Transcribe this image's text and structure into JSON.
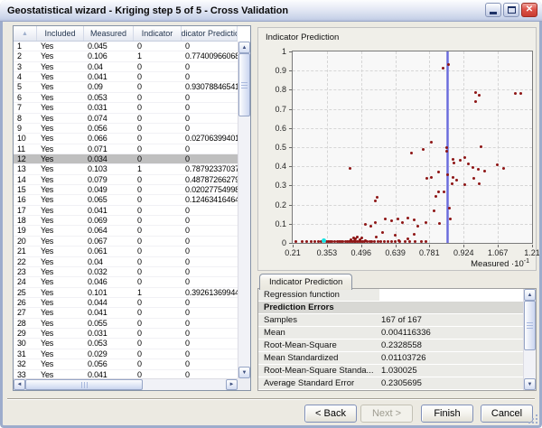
{
  "window": {
    "title": "Geostatistical wizard - Kriging step 5 of 5 - Cross Validation"
  },
  "icons": {
    "sort_ascending": "▲",
    "minimize": "–",
    "maximize": "□",
    "close": "✕",
    "scroll_up": "▲",
    "scroll_down": "▼",
    "scroll_left": "◄",
    "scroll_right": "►"
  },
  "table": {
    "headers": [
      "",
      "Included",
      "Measured",
      "Indicator",
      "Indicator Prediction"
    ],
    "selected_row": 12,
    "rows": [
      [
        "1",
        "Yes",
        "0.045",
        "0",
        "0"
      ],
      [
        "2",
        "Yes",
        "0.106",
        "1",
        "0.774009660680..."
      ],
      [
        "3",
        "Yes",
        "0.04",
        "0",
        "0"
      ],
      [
        "4",
        "Yes",
        "0.041",
        "0",
        "0"
      ],
      [
        "5",
        "Yes",
        "0.09",
        "0",
        "0.930788465417..."
      ],
      [
        "6",
        "Yes",
        "0.053",
        "0",
        "0"
      ],
      [
        "7",
        "Yes",
        "0.031",
        "0",
        "0"
      ],
      [
        "8",
        "Yes",
        "0.074",
        "0",
        "0"
      ],
      [
        "9",
        "Yes",
        "0.056",
        "0",
        "0"
      ],
      [
        "10",
        "Yes",
        "0.066",
        "0",
        "0.027063994010..."
      ],
      [
        "11",
        "Yes",
        "0.071",
        "0",
        "0"
      ],
      [
        "12",
        "Yes",
        "0.034",
        "0",
        "0"
      ],
      [
        "13",
        "Yes",
        "0.103",
        "1",
        "0.787923370375..."
      ],
      [
        "14",
        "Yes",
        "0.079",
        "0",
        "0.487872662791..."
      ],
      [
        "15",
        "Yes",
        "0.049",
        "0",
        "0.020277549986..."
      ],
      [
        "16",
        "Yes",
        "0.065",
        "0",
        "0.12463416464..."
      ],
      [
        "17",
        "Yes",
        "0.041",
        "0",
        "0"
      ],
      [
        "18",
        "Yes",
        "0.069",
        "0",
        "0"
      ],
      [
        "19",
        "Yes",
        "0.064",
        "0",
        "0"
      ],
      [
        "20",
        "Yes",
        "0.067",
        "0",
        "0"
      ],
      [
        "21",
        "Yes",
        "0.061",
        "0",
        "0"
      ],
      [
        "22",
        "Yes",
        "0.04",
        "0",
        "0"
      ],
      [
        "23",
        "Yes",
        "0.032",
        "0",
        "0"
      ],
      [
        "24",
        "Yes",
        "0.046",
        "0",
        "0"
      ],
      [
        "25",
        "Yes",
        "0.101",
        "1",
        "0.392613699448..."
      ],
      [
        "26",
        "Yes",
        "0.044",
        "0",
        "0"
      ],
      [
        "27",
        "Yes",
        "0.041",
        "0",
        "0"
      ],
      [
        "28",
        "Yes",
        "0.055",
        "0",
        "0"
      ],
      [
        "29",
        "Yes",
        "0.031",
        "0",
        "0"
      ],
      [
        "30",
        "Yes",
        "0.053",
        "0",
        "0"
      ],
      [
        "31",
        "Yes",
        "0.029",
        "0",
        "0"
      ],
      [
        "32",
        "Yes",
        "0.056",
        "0",
        "0"
      ],
      [
        "33",
        "Yes",
        "0.041",
        "0",
        "0"
      ]
    ]
  },
  "chart_data": {
    "type": "scatter",
    "title": "Indicator Prediction",
    "xlabel_base": "Measured ·10",
    "xlabel_exp": "-1",
    "xlim": [
      0.21,
      1.21
    ],
    "ylim": [
      0,
      1
    ],
    "x_ticks": [
      "0.21",
      "0.353",
      "0.496",
      "0.639",
      "0.781",
      "0.924",
      "1.067",
      "1.21"
    ],
    "y_ticks": [
      "1",
      "0.9",
      "0.8",
      "0.7",
      "0.6",
      "0.5",
      "0.4",
      "0.3",
      "0.2",
      "0.1",
      "0"
    ],
    "grid": true,
    "reference_line_x": 0.858,
    "point_color": "#8E1616",
    "selected_point_color": "#17E2E2",
    "reference_line_color": "#5D5FD6",
    "selected_point": [
      0.34,
      0
    ],
    "points": [
      [
        0.225,
        0
      ],
      [
        0.248,
        0
      ],
      [
        0.268,
        0
      ],
      [
        0.288,
        0
      ],
      [
        0.302,
        0
      ],
      [
        0.316,
        0
      ],
      [
        0.328,
        0
      ],
      [
        0.352,
        0
      ],
      [
        0.36,
        0
      ],
      [
        0.368,
        0
      ],
      [
        0.376,
        0
      ],
      [
        0.384,
        0
      ],
      [
        0.395,
        0
      ],
      [
        0.405,
        0
      ],
      [
        0.413,
        0
      ],
      [
        0.421,
        0
      ],
      [
        0.43,
        0
      ],
      [
        0.438,
        0
      ],
      [
        0.447,
        0
      ],
      [
        0.455,
        0
      ],
      [
        0.462,
        0
      ],
      [
        0.468,
        0
      ],
      [
        0.474,
        0
      ],
      [
        0.48,
        0
      ],
      [
        0.487,
        0
      ],
      [
        0.494,
        0
      ],
      [
        0.501,
        0
      ],
      [
        0.51,
        0
      ],
      [
        0.52,
        0
      ],
      [
        0.531,
        0
      ],
      [
        0.542,
        0
      ],
      [
        0.553,
        0
      ],
      [
        0.565,
        0
      ],
      [
        0.578,
        0
      ],
      [
        0.592,
        0
      ],
      [
        0.607,
        0
      ],
      [
        0.623,
        0
      ],
      [
        0.64,
        0
      ],
      [
        0.658,
        0
      ],
      [
        0.678,
        0
      ],
      [
        0.7,
        0
      ],
      [
        0.722,
        0
      ],
      [
        0.747,
        0
      ],
      [
        0.765,
        0
      ],
      [
        0.452,
        0.018
      ],
      [
        0.463,
        0.028
      ],
      [
        0.472,
        0.022
      ],
      [
        0.481,
        0.03
      ],
      [
        0.49,
        0.018
      ],
      [
        0.498,
        0.025
      ],
      [
        0.468,
        0.012
      ],
      [
        0.515,
        0.012
      ],
      [
        0.558,
        0.033
      ],
      [
        0.585,
        0.056
      ],
      [
        0.637,
        0.04
      ],
      [
        0.655,
        0.012
      ],
      [
        0.69,
        0.022
      ],
      [
        0.717,
        0.047
      ],
      [
        0.513,
        0.097
      ],
      [
        0.535,
        0.089
      ],
      [
        0.557,
        0.107
      ],
      [
        0.596,
        0.126
      ],
      [
        0.622,
        0.117
      ],
      [
        0.648,
        0.126
      ],
      [
        0.667,
        0.107
      ],
      [
        0.693,
        0.128
      ],
      [
        0.719,
        0.12
      ],
      [
        0.733,
        0.089
      ],
      [
        0.768,
        0.107
      ],
      [
        0.8,
        0.166
      ],
      [
        0.822,
        0.101
      ],
      [
        0.87,
        0.123
      ],
      [
        0.555,
        0.218
      ],
      [
        0.561,
        0.24
      ],
      [
        0.45,
        0.389
      ],
      [
        0.77,
        0.338
      ],
      [
        0.789,
        0.341
      ],
      [
        0.808,
        0.245
      ],
      [
        0.82,
        0.268
      ],
      [
        0.843,
        0.268
      ],
      [
        0.858,
        0.354
      ],
      [
        0.878,
        0.341
      ],
      [
        0.821,
        0.372
      ],
      [
        0.866,
        0.182
      ],
      [
        0.895,
        0.33
      ],
      [
        0.876,
        0.307
      ],
      [
        0.928,
        0.302
      ],
      [
        0.968,
        0.338
      ],
      [
        0.988,
        0.307
      ],
      [
        1.012,
        0.377
      ],
      [
        1.065,
        0.408
      ],
      [
        1.093,
        0.388
      ],
      [
        0.962,
        0.392
      ],
      [
        0.985,
        0.385
      ],
      [
        0.708,
        0.469
      ],
      [
        0.754,
        0.486
      ],
      [
        0.789,
        0.525
      ],
      [
        0.855,
        0.497
      ],
      [
        0.855,
        0.481
      ],
      [
        0.879,
        0.436
      ],
      [
        0.885,
        0.419
      ],
      [
        0.91,
        0.43
      ],
      [
        0.928,
        0.447
      ],
      [
        0.944,
        0.413
      ],
      [
        0.995,
        0.502
      ],
      [
        0.84,
        0.913
      ],
      [
        0.862,
        0.932
      ],
      [
        0.974,
        0.787
      ],
      [
        0.99,
        0.772
      ],
      [
        0.976,
        0.74
      ],
      [
        1.14,
        0.78
      ],
      [
        1.162,
        0.78
      ]
    ]
  },
  "results_tab": {
    "label": "Indicator Prediction"
  },
  "stats": {
    "rows": [
      {
        "label": "Regression function",
        "value": "",
        "type": "input"
      },
      {
        "label": "Prediction Errors",
        "value": "",
        "type": "section"
      },
      {
        "label": "Samples",
        "value": "167 of 167",
        "type": "data"
      },
      {
        "label": "Mean",
        "value": "0.004116336",
        "type": "data"
      },
      {
        "label": "Root-Mean-Square",
        "value": "0.2328558",
        "type": "data"
      },
      {
        "label": "Mean Standardized",
        "value": "0.01103726",
        "type": "data"
      },
      {
        "label": "Root-Mean-Square Standa...",
        "value": "1.030025",
        "type": "data"
      },
      {
        "label": "Average Standard Error",
        "value": "0.2305695",
        "type": "data"
      }
    ]
  },
  "buttons": {
    "back": "< Back",
    "next": "Next >",
    "finish": "Finish",
    "cancel": "Cancel"
  }
}
